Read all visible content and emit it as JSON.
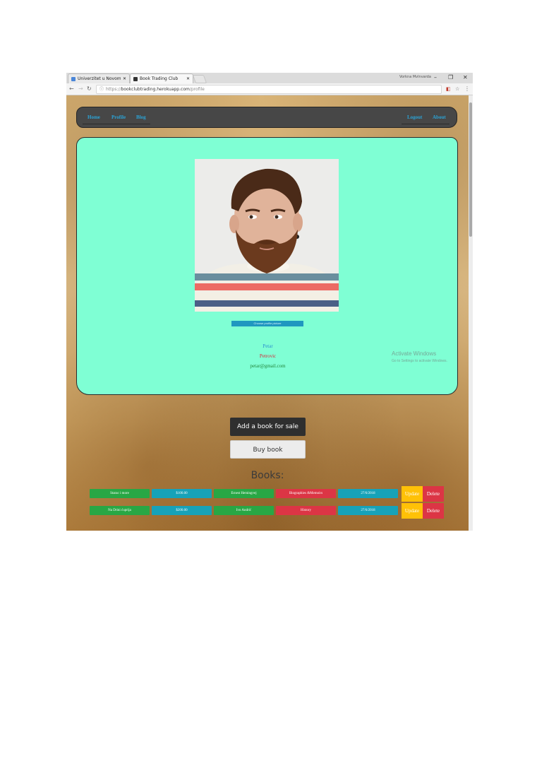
{
  "browser": {
    "tabs": [
      {
        "title": "Univerzitet u Novom Sad",
        "active": false
      },
      {
        "title": "Book Trading Club",
        "active": true
      }
    ],
    "user": "Vorkna Mvlnvarda",
    "url_domain": "bookclubtrading.herokuapp.com",
    "url_path": "/profile",
    "url_scheme": "https://"
  },
  "nav": {
    "left": [
      "Home",
      "Profile",
      "Blog"
    ],
    "right": [
      "Logout",
      "About"
    ]
  },
  "profile": {
    "first_name": "Petar",
    "last_name": "Petrovic",
    "email": "petar@gmail.com",
    "photo_button_label": "Choose profile picture"
  },
  "watermark": {
    "line1": "Activate Windows",
    "line2": "Go to Settings to activate Windows."
  },
  "actions": {
    "add_book": "Add a book for sale",
    "buy_book": "Buy book"
  },
  "books_heading": "Books:",
  "books": [
    {
      "title": "Starac i more",
      "price": "$100.00",
      "author": "Ernest Hemingvej",
      "genre": "Biographies &Memoirs",
      "date": "27/6/2018"
    },
    {
      "title": "Na Drini ćuprija",
      "price": "$200.00",
      "author": "Ivo Andrić",
      "genre": "History",
      "date": "27/6/2018"
    }
  ],
  "row_buttons": {
    "update": "Update",
    "delete": "Delete"
  },
  "colors": {
    "card": "#7fffd4",
    "navbar": "#474747",
    "link": "#2ba3d6",
    "title_cell": "#28a745",
    "price_cell": "#17a2b8",
    "genre_cell": "#dc3545",
    "update": "#ffc107",
    "delete": "#dc3545"
  }
}
